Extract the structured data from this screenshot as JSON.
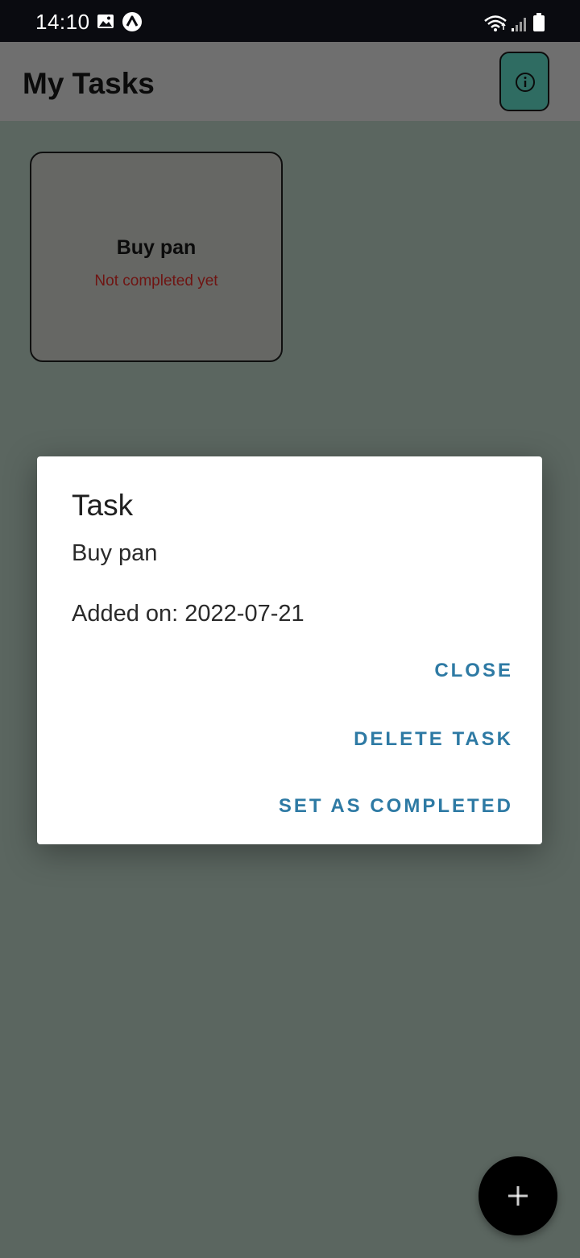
{
  "status_bar": {
    "time": "14:10",
    "icons": [
      "image-icon",
      "app-notification-icon",
      "wifi-icon",
      "signal-icon",
      "battery-icon"
    ]
  },
  "header": {
    "title": "My Tasks",
    "info_icon": "info-icon",
    "accent_color": "#2f6c62"
  },
  "tasks": [
    {
      "title": "Buy pan",
      "status": "Not completed yet",
      "status_color": "#6f1412"
    }
  ],
  "dialog": {
    "title": "Task",
    "task_name": "Buy pan",
    "added_on": "Added on: 2022-07-21",
    "buttons": {
      "close": "CLOSE",
      "delete": "DELETE TASK",
      "complete": "SET AS COMPLETED"
    },
    "button_color": "#2e7aa4"
  },
  "fab": {
    "icon": "plus-icon"
  }
}
